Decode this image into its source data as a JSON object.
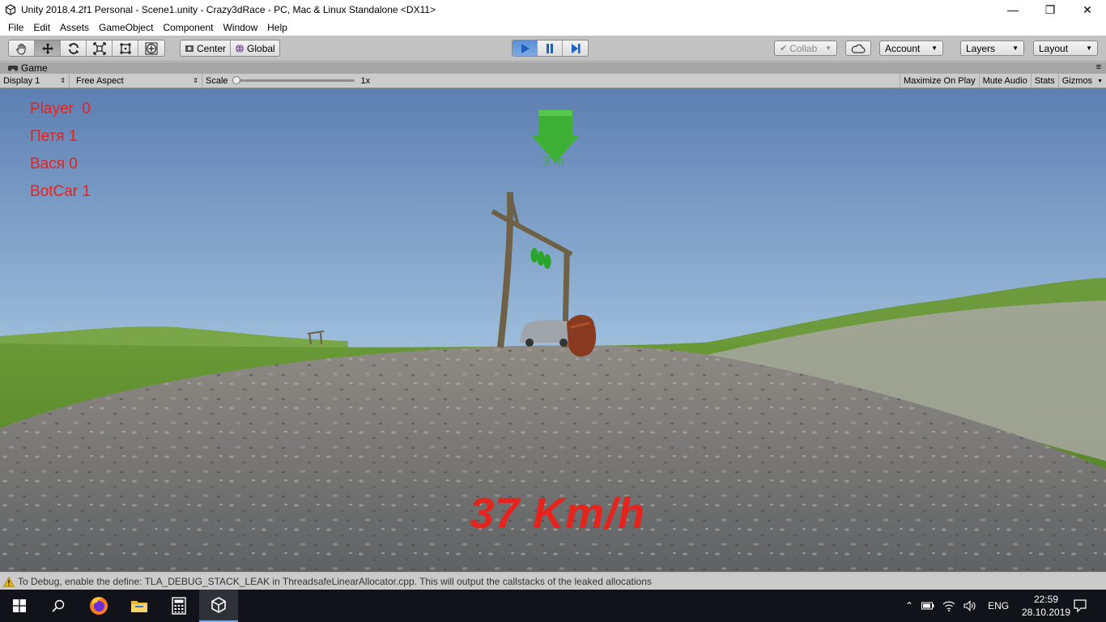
{
  "window": {
    "title": "Unity 2018.4.2f1 Personal - Scene1.unity - Crazy3dRace - PC, Mac & Linux Standalone <DX11>"
  },
  "menu": [
    "File",
    "Edit",
    "Assets",
    "GameObject",
    "Component",
    "Window",
    "Help"
  ],
  "toolbar": {
    "pivot_center": "Center",
    "pivot_global": "Global",
    "collab": "Collab",
    "account": "Account",
    "layers": "Layers",
    "layout": "Layout"
  },
  "game_tab": {
    "label": "Game",
    "display": "Display 1",
    "aspect": "Free Aspect",
    "scale_label": "Scale",
    "scale_value": "1x",
    "maximize": "Maximize On Play",
    "mute": "Mute Audio",
    "stats": "Stats",
    "gizmos": "Gizmos"
  },
  "hud": {
    "scores": [
      {
        "text": "Player  0"
      },
      {
        "text": "Петя 1"
      },
      {
        "text": "Вася 0"
      },
      {
        "text": "BotCar 1"
      }
    ],
    "distance": "3 m",
    "speed": "37 Km/h"
  },
  "status": {
    "message": "To Debug, enable the define: TLA_DEBUG_STACK_LEAK in ThreadsafeLinearAllocator.cpp. This will output the callstacks of the leaked allocations"
  },
  "taskbar": {
    "language": "ENG",
    "time": "22:59",
    "date": "28.10.2019"
  },
  "colors": {
    "hud_text": "#e8211d",
    "play_active": "#5a8fd6",
    "marker_green": "#3cae3a"
  }
}
